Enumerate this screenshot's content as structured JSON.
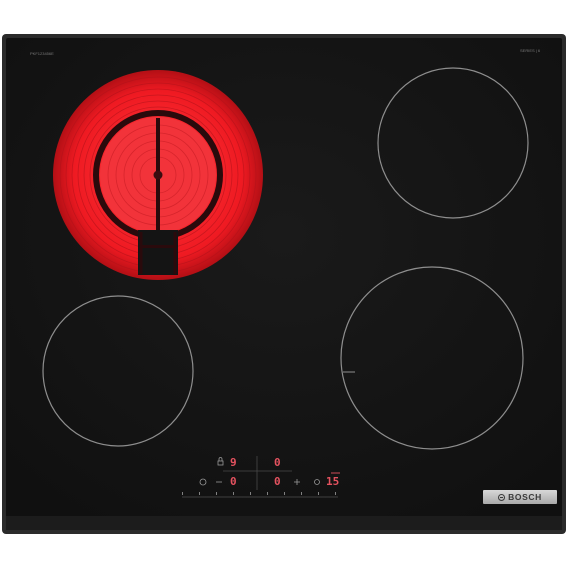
{
  "appliance": {
    "model_code": "PKF123456E",
    "series_label": "SERIES | 6",
    "brand": "BOSCH"
  },
  "colors": {
    "glass": "#141414",
    "frame": "#2b2b2b",
    "zone_outline": "#8e8e8e",
    "heating_red": "#f0202a",
    "display_red": "#e4525f"
  },
  "zones": [
    {
      "id": "front-left-active",
      "state": "heating"
    },
    {
      "id": "back-right",
      "state": "off"
    },
    {
      "id": "rear-left",
      "state": "off"
    },
    {
      "id": "front-right",
      "state": "off"
    }
  ],
  "control_panel": {
    "left_display_top": "9",
    "left_display_bottom": "0",
    "right_display_top": "0",
    "right_display_bottom": "0",
    "timer_display": "15",
    "power_scale": [
      "0",
      "1",
      "2",
      "3",
      "4",
      "5",
      "6",
      "7",
      "8",
      "9"
    ],
    "icons": [
      "zone-select-icon",
      "lock-icon",
      "timer-icon",
      "minus-icon",
      "plus-icon"
    ]
  }
}
